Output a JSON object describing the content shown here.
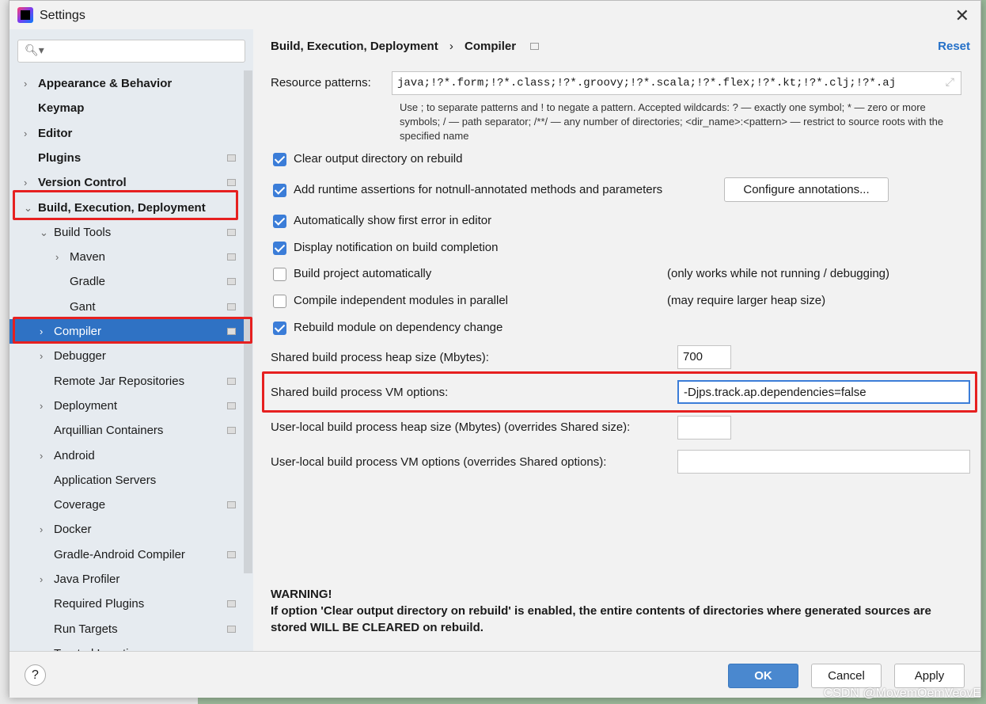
{
  "window": {
    "title": "Settings",
    "close": "✕"
  },
  "sidebar": {
    "items": [
      {
        "label": "Appearance & Behavior",
        "arrow": "›",
        "bold": true
      },
      {
        "label": "Keymap",
        "bold": true
      },
      {
        "label": "Editor",
        "arrow": "›",
        "bold": true
      },
      {
        "label": "Plugins",
        "bold": true,
        "page": true
      },
      {
        "label": "Version Control",
        "arrow": "›",
        "bold": true,
        "page": true
      },
      {
        "label": "Build, Execution, Deployment",
        "arrow": "⌄",
        "bold": true
      },
      {
        "label": "Build Tools",
        "arrow": "⌄",
        "level": 1,
        "page": true
      },
      {
        "label": "Maven",
        "arrow": "›",
        "level": 2,
        "page": true
      },
      {
        "label": "Gradle",
        "level": 2,
        "page": true
      },
      {
        "label": "Gant",
        "level": 2,
        "page": true
      },
      {
        "label": "Compiler",
        "arrow": "›",
        "level": 1,
        "page": true,
        "selected": true
      },
      {
        "label": "Debugger",
        "arrow": "›",
        "level": 1
      },
      {
        "label": "Remote Jar Repositories",
        "level": 1,
        "page": true
      },
      {
        "label": "Deployment",
        "arrow": "›",
        "level": 1,
        "page": true
      },
      {
        "label": "Arquillian Containers",
        "level": 1,
        "page": true
      },
      {
        "label": "Android",
        "arrow": "›",
        "level": 1
      },
      {
        "label": "Application Servers",
        "level": 1
      },
      {
        "label": "Coverage",
        "level": 1,
        "page": true
      },
      {
        "label": "Docker",
        "arrow": "›",
        "level": 1
      },
      {
        "label": "Gradle-Android Compiler",
        "level": 1,
        "page": true
      },
      {
        "label": "Java Profiler",
        "arrow": "›",
        "level": 1
      },
      {
        "label": "Required Plugins",
        "level": 1,
        "page": true
      },
      {
        "label": "Run Targets",
        "level": 1,
        "page": true
      },
      {
        "label": "Trusted Locations",
        "level": 1
      }
    ]
  },
  "content": {
    "breadcrumb": [
      "Build, Execution, Deployment",
      "Compiler"
    ],
    "breadcrumb_sep": "›",
    "reset": "Reset",
    "resource_label": "Resource patterns:",
    "resource_value": "java;!?*.form;!?*.class;!?*.groovy;!?*.scala;!?*.flex;!?*.kt;!?*.clj;!?*.aj",
    "hint": "Use ; to separate patterns and ! to negate a pattern. Accepted wildcards: ? — exactly one symbol; * — zero or more symbols; / — path separator; /**/ — any number of directories; <dir_name>:<pattern> — restrict to source roots with the specified name",
    "checkboxes": [
      {
        "label": "Clear output directory on rebuild",
        "checked": true
      },
      {
        "label": "Add runtime assertions for notnull-annotated methods and parameters",
        "checked": true
      },
      {
        "label": "Automatically show first error in editor",
        "checked": true
      },
      {
        "label": "Display notification on build completion",
        "checked": true
      },
      {
        "label": "Build project automatically",
        "checked": false,
        "note": "(only works while not running / debugging)"
      },
      {
        "label": "Compile independent modules in parallel",
        "checked": false,
        "note": "(may require larger heap size)"
      },
      {
        "label": "Rebuild module on dependency change",
        "checked": true
      }
    ],
    "configure_annotations": "Configure annotations...",
    "heap_label": "Shared build process heap size (Mbytes):",
    "heap_value": "700",
    "vm_label": "Shared build process VM options:",
    "vm_value": "-Djps.track.ap.dependencies=false",
    "local_heap_label": "User-local build process heap size (Mbytes) (overrides Shared size):",
    "local_heap_value": "",
    "local_vm_label": "User-local build process VM options (overrides Shared options):",
    "local_vm_value": "",
    "warning_title": "WARNING!",
    "warning_text": "If option 'Clear output directory on rebuild' is enabled, the entire contents of directories where generated sources are stored WILL BE CLEARED on rebuild."
  },
  "footer": {
    "help": "?",
    "ok": "OK",
    "cancel": "Cancel",
    "apply": "Apply"
  },
  "watermark": "CSDN @MovemOemVeovE",
  "colors": {
    "accent": "#2f72c4",
    "highlight": "#e62020",
    "ok_button": "#4a88cf"
  }
}
